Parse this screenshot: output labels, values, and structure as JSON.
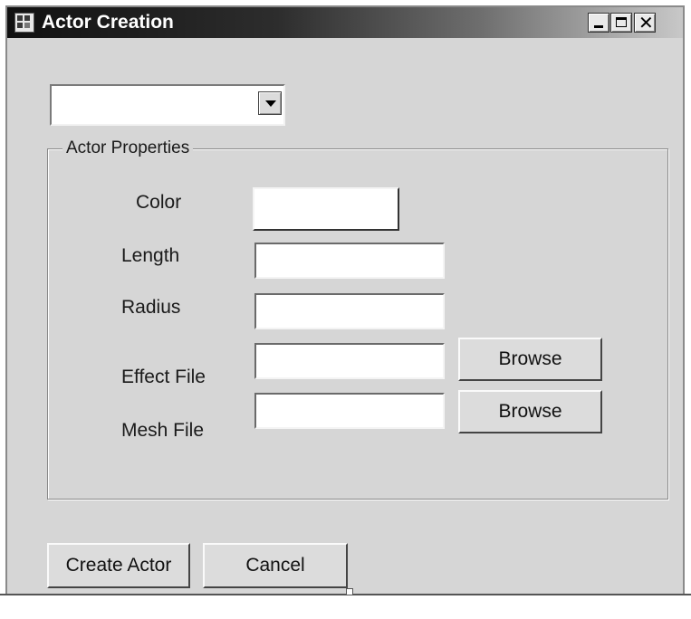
{
  "window": {
    "title": "Actor Creation",
    "icon": "app-window-icon",
    "controls": {
      "minimize_icon": "minimize-icon",
      "maximize_icon": "maximize-icon",
      "close_glyph": "✕"
    }
  },
  "actor_type_combo": {
    "value": "",
    "arrow_icon": "chevron-down-icon"
  },
  "properties": {
    "group_label": "Actor Properties",
    "color": {
      "label": "Color",
      "value": ""
    },
    "length": {
      "label": "Length",
      "value": ""
    },
    "radius": {
      "label": "Radius",
      "value": ""
    },
    "effect_file": {
      "label": "Effect File",
      "value": "",
      "browse_label": "Browse"
    },
    "mesh_file": {
      "label": "Mesh File",
      "value": "",
      "browse_label": "Browse"
    }
  },
  "actions": {
    "create_label": "Create Actor",
    "cancel_label": "Cancel"
  },
  "colors": {
    "window_bg": "#d6d6d6",
    "titlebar_start": "#111111",
    "titlebar_end": "#c8c8c8"
  }
}
